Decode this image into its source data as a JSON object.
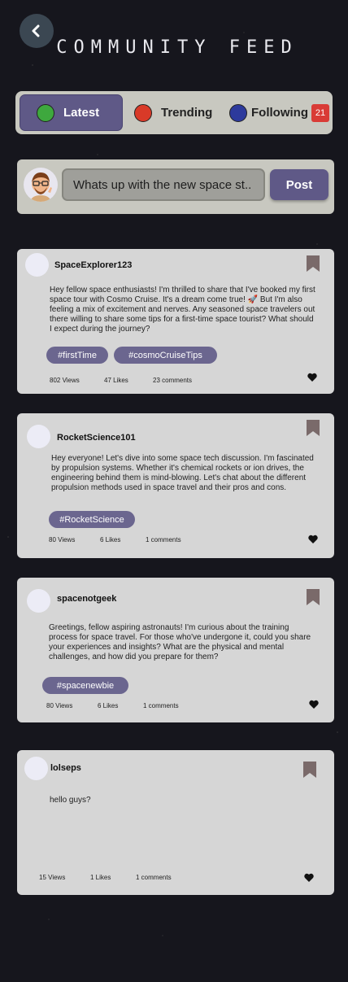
{
  "header": {
    "title": "COMMUNITY FEED",
    "back_icon": "chevron-left-icon"
  },
  "tabs": [
    {
      "label": "Latest",
      "color": "#3ea83e",
      "active": true
    },
    {
      "label": "Trending",
      "color": "#d93a28",
      "active": false
    },
    {
      "label": "Following",
      "color": "#2d3a9c",
      "active": false,
      "badge": "21"
    }
  ],
  "composer": {
    "value": "Whats up with the new space st..",
    "post_label": "Post"
  },
  "posts": [
    {
      "username": "SpaceExplorer123",
      "body": "Hey fellow space enthusiasts! I'm thrilled to share that I've booked my first space tour with Cosmo Cruise. It's a dream come true! 🚀 But I'm also feeling a mix of excitement and nerves. Any seasoned space travelers out there willing to share some tips for a first-time space tourist? What should I expect during the journey?",
      "tags": [
        "#firstTime",
        "#cosmoCruiseTips"
      ],
      "views": "802 Views",
      "likes": "47 Likes",
      "comments": "23 comments"
    },
    {
      "username": "RocketScience101",
      "body": "Hey everyone! Let's dive into some space tech discussion. I'm fascinated by propulsion systems. Whether it's chemical rockets or ion drives, the engineering behind them is mind-blowing. Let's chat about the different propulsion methods used in space travel and their pros and cons.",
      "tags": [
        "#RocketScience"
      ],
      "views": "80 Views",
      "likes": "6 Likes",
      "comments": "1 comments"
    },
    {
      "username": "spacenotgeek",
      "body": "Greetings, fellow aspiring astronauts! I'm curious about the training process for space travel. For those who've undergone it, could you share your experiences and insights? What are the physical and mental challenges, and how did you prepare for them?",
      "tags": [
        "#spacenewbie"
      ],
      "views": "80 Views",
      "likes": "6 Likes",
      "comments": "1 comments"
    },
    {
      "username": "lolseps",
      "body": "hello guys?",
      "tags": [],
      "views": "15 Views",
      "likes": "1 Likes",
      "comments": "1 comments"
    }
  ],
  "colors": {
    "accent": "#5f5987",
    "tag": "#6b668f",
    "panel": "#c8c8c0",
    "card": "#d6d6d6",
    "bookmark": "#7a6a6a",
    "badge": "#d93b36"
  }
}
